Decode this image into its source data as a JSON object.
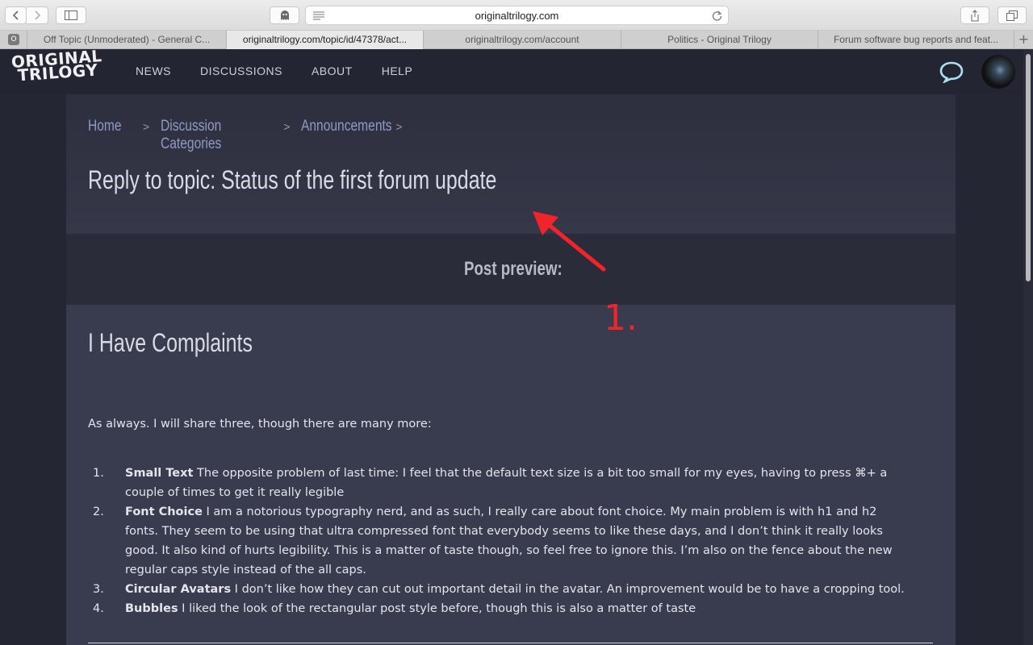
{
  "browser": {
    "url": "originaltrilogy.com",
    "tabs": [
      {
        "label": "Off Topic (Unmoderated) - General C...",
        "favicon": "O"
      },
      {
        "label": "originaltrilogy.com/topic/id/47378/act..."
      },
      {
        "label": "originaltrilogy.com/account"
      },
      {
        "label": "Politics - Original Trilogy"
      },
      {
        "label": "Forum software bug reports and feat..."
      }
    ],
    "new_tab": "+"
  },
  "site": {
    "logo_line1": "ORIGINAL",
    "logo_line2": "TRILOGY",
    "nav": [
      "NEWS",
      "DISCUSSIONS",
      "ABOUT",
      "HELP"
    ]
  },
  "breadcrumb": {
    "items": [
      "Home",
      "Discussion Categories",
      "Announcements"
    ],
    "separator": ">"
  },
  "page_title": "Reply to topic: Status of the first forum update",
  "preview_label": "Post preview:",
  "post": {
    "title": "I Have Complaints",
    "intro": "As always. I will share three, though there are many more:",
    "items": [
      {
        "num": "1.",
        "heading": "Small Text",
        "text": " The opposite problem of last time: I feel that the default text size is a bit too small for my eyes, having to press ⌘+ a couple of times to get it really legible"
      },
      {
        "num": "2.",
        "heading": "Font Choice",
        "text": " I am a notorious typography nerd, and as such, I really care about font choice. My main problem is with h1 and h2 fonts. They seem to be using that ultra compressed font that everybody seems to like these days, and I don’t think it really looks good. It also kind of hurts legibility. This is a matter of taste though, so feel free to ignore this. I’m also on the fence about the new regular caps style instead of the all caps."
      },
      {
        "num": "3.",
        "heading": "Circular Avatars",
        "text": " I don’t like how they can cut out important detail in the avatar. An improvement would be to have a cropping tool."
      },
      {
        "num": "4.",
        "heading": "Bubbles",
        "text": " I liked the look of the rectangular post style before, though this is also a matter of taste"
      }
    ]
  },
  "annotation": {
    "label": "1.",
    "color": "#f0242a"
  },
  "colors": {
    "header_bg": "#232532",
    "panel_bg": "#393b4e",
    "link": "#8f9bc4"
  }
}
